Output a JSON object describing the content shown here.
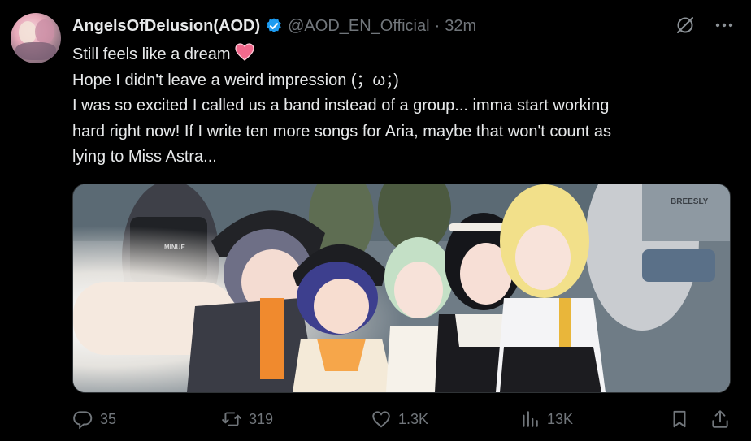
{
  "tweet": {
    "display_name": "AngelsOfDelusion(AOD)",
    "handle": "@AOD_EN_Official",
    "separator": "·",
    "time": "32m",
    "lines": [
      "Still feels like a dream",
      "Hope I didn't leave a weird impression (；ω；)",
      "I was so excited I called us a band instead of a group... imma start working",
      "hard right now! If I write ten more songs for Aria, maybe that won't count as",
      "lying to Miss Astra..."
    ],
    "verified_color": "#1d9bf0",
    "heart_emoji_color": "#f26a8d"
  },
  "actions": {
    "replies": "35",
    "reposts": "319",
    "likes": "1.3K",
    "views": "13K"
  },
  "icons": {
    "grok": "grok-icon",
    "more": "more-dots-icon",
    "reply": "reply-icon",
    "repost": "repost-icon",
    "like": "like-icon",
    "views": "views-icon",
    "bookmark": "bookmark-icon",
    "share": "share-icon"
  },
  "media": {
    "shirt_text": "BREESLY",
    "strap_text": "MINUE"
  }
}
